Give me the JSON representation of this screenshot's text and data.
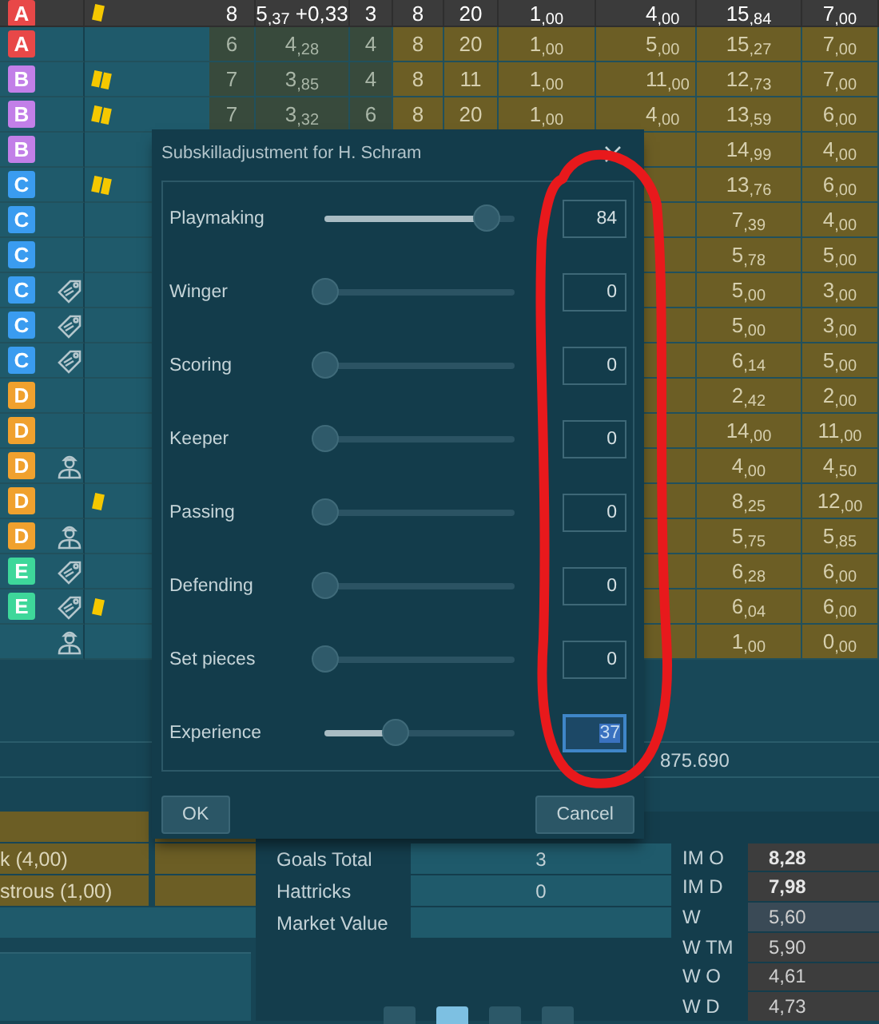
{
  "table": {
    "rows": [
      {
        "position": "A",
        "color": "#e84848",
        "selected": true,
        "icons": [
          {
            "kind": "card"
          }
        ],
        "column_4": "8",
        "column_5": "5$_{,37}$ +0,33",
        "column_6": "3",
        "column_7": "8",
        "column_8": "20",
        "column_9": "1$_{,00}$",
        "column_10": "4$_{,00}$",
        "column_11": "15$_{,84}$",
        "column_12": "7$_{,00}$"
      },
      {
        "position": "A",
        "color": "#e84848",
        "selected": false,
        "column_4": "6",
        "column_5": "4$_{,28}$",
        "column_6": "4",
        "column_7": "8",
        "column_8": "20",
        "column_9": "1$_{,00}$",
        "column_10": "5$_{,00}$",
        "column_11": "15$_{,27}$",
        "column_12": "7$_{,00}$"
      },
      {
        "position": "B",
        "color": "#c27fe8",
        "selected": false,
        "icons": [
          {
            "kind": "double_card"
          }
        ],
        "column_4": "7",
        "column_5": "3$_{,85}$",
        "column_6": "4",
        "column_7": "8",
        "column_8": "11",
        "column_9": "1$_{,00}$",
        "column_10": "11$_{,00}$",
        "column_11": "12$_{,73}$",
        "column_12": "7$_{,00}$"
      },
      {
        "position": "B",
        "color": "#c27fe8",
        "selected": false,
        "icons": [
          {
            "kind": "double_card"
          }
        ],
        "column_4": "7",
        "column_5": "3$_{,32}$",
        "column_6": "6",
        "column_7": "8",
        "column_8": "20",
        "column_9": "1$_{,00}$",
        "column_10": "4$_{,00}$",
        "column_11": "13$_{,59}$",
        "column_12": "6$_{,00}$"
      },
      {
        "position": "B",
        "color": "#c27fe8",
        "selected": false,
        "column_11": "14$_{,99}$",
        "column_12": "4$_{,00}$"
      },
      {
        "position": "C",
        "color": "#3a9cf0",
        "selected": false,
        "icons": [
          {
            "kind": "double_card"
          }
        ],
        "column_11": "13$_{,76}$",
        "column_12": "6$_{,00}$"
      },
      {
        "position": "C",
        "color": "#3a9cf0",
        "selected": false,
        "column_11": "7$_{,39}$",
        "column_12": "4$_{,00}$"
      },
      {
        "position": "C",
        "color": "#3a9cf0",
        "selected": false,
        "column_11": "5$_{,78}$",
        "column_12": "5$_{,00}$"
      },
      {
        "position": "C",
        "color": "#3a9cf0",
        "selected": false,
        "icons": [
          {
            "kind": "tag"
          }
        ],
        "column_11": "5$_{,00}$",
        "column_12": "3$_{,00}$"
      },
      {
        "position": "C",
        "color": "#3a9cf0",
        "selected": false,
        "icons": [
          {
            "kind": "tag"
          }
        ],
        "column_11": "5$_{,00}$",
        "column_12": "3$_{,00}$"
      },
      {
        "position": "C",
        "color": "#3a9cf0",
        "selected": false,
        "icons": [
          {
            "kind": "tag"
          }
        ],
        "column_11": "6$_{,14}$",
        "column_12": "5$_{,00}$"
      },
      {
        "position": "D",
        "color": "#f0a12e",
        "selected": false,
        "column_11": "2$_{,42}$",
        "column_12": "2$_{,00}$"
      },
      {
        "position": "D",
        "color": "#f0a12e",
        "selected": false,
        "column_11": "14$_{,00}$",
        "column_12": "11$_{,00}$"
      },
      {
        "position": "D",
        "color": "#f0a12e",
        "selected": false,
        "icons": [
          {
            "kind": "person"
          }
        ],
        "column_11": "4$_{,00}$",
        "column_12": "4$_{,50}$"
      },
      {
        "position": "D",
        "color": "#f0a12e",
        "selected": false,
        "icons": [
          {
            "kind": "card"
          }
        ],
        "column_11": "8$_{,25}$",
        "column_12": "12$_{,00}$"
      },
      {
        "position": "D",
        "color": "#f0a12e",
        "selected": false,
        "icons": [
          {
            "kind": "person"
          }
        ],
        "column_11": "5$_{,75}$",
        "column_12": "5$_{,85}$"
      },
      {
        "position": "E",
        "color": "#3ed79a",
        "selected": false,
        "icons": [
          {
            "kind": "tag"
          }
        ],
        "column_11": "6$_{,28}$",
        "column_12": "6$_{,00}$"
      },
      {
        "position": "E",
        "color": "#3ed79a",
        "selected": false,
        "icons": [
          {
            "kind": "tag"
          },
          {
            "kind": "card"
          }
        ],
        "column_11": "6$_{,04}$",
        "column_12": "6$_{,00}$"
      },
      {
        "selected": false,
        "icons": [
          {
            "kind": "person"
          }
        ],
        "column_11": "1$_{,00}$",
        "column_12": "0$_{,00}$"
      }
    ]
  },
  "total": "875.690",
  "dialog": {
    "title": "Subskilladjustment for H. Schram",
    "sliders": [
      {
        "label": "Playmaking",
        "level": 0.85,
        "value": "84",
        "focused": false
      },
      {
        "label": "Winger",
        "level": 0,
        "value": "0",
        "focused": false
      },
      {
        "label": "Scoring",
        "level": 0,
        "value": "0",
        "focused": false
      },
      {
        "label": "Keeper",
        "level": 0,
        "value": "0",
        "focused": false
      },
      {
        "label": "Passing",
        "level": 0,
        "value": "0",
        "focused": false
      },
      {
        "label": "Defending",
        "level": 0,
        "value": "0",
        "focused": false
      },
      {
        "label": "Set pieces",
        "level": 0,
        "value": "0",
        "focused": false
      },
      {
        "label": "Experience",
        "level": 0.37,
        "value": "37",
        "focused": true
      }
    ],
    "buttons": [
      "OK",
      "Cancel"
    ]
  },
  "specialties": [
    "k (4,00)",
    "strous (1,00)"
  ],
  "stats": [
    {
      "label": "Goals Total",
      "value": "3"
    },
    {
      "label": "Hattricks",
      "value": "0"
    },
    {
      "label": "Market Value"
    }
  ],
  "ratings": [
    {
      "label": "IM O",
      "value": "8,28",
      "emphasized": true,
      "selected": false
    },
    {
      "label": "IM D",
      "value": "7,98",
      "emphasized": true,
      "selected": false
    },
    {
      "label": "W",
      "value": "5,60",
      "emphasized": false,
      "selected": true
    },
    {
      "label": "W TM",
      "value": "5,90",
      "emphasized": false,
      "selected": false
    },
    {
      "label": "W O",
      "value": "4,61",
      "emphasized": false,
      "selected": false
    },
    {
      "label": "W D",
      "value": "4,73",
      "emphasized": false,
      "selected": false
    }
  ],
  "pager": [
    {
      "selected": false
    },
    {
      "selected": true
    },
    {
      "selected": false
    },
    {
      "selected": false
    }
  ]
}
